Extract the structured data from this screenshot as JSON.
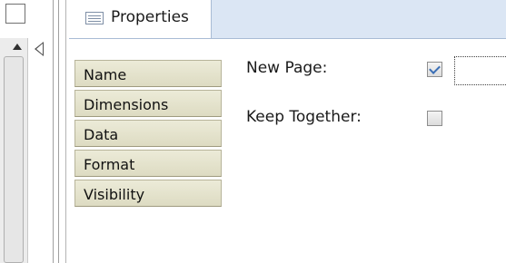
{
  "tab": {
    "label": "Properties"
  },
  "categories": [
    {
      "label": "Name"
    },
    {
      "label": "Dimensions"
    },
    {
      "label": "Data"
    },
    {
      "label": "Format"
    },
    {
      "label": "Visibility"
    }
  ],
  "properties": [
    {
      "label": "New Page:",
      "checked": true
    },
    {
      "label": "Keep Together:",
      "checked": false
    }
  ],
  "colors": {
    "tab_strip": "#dbe6f4",
    "category_bg": "#e4e2cc",
    "check_mark": "#3b6fb6"
  }
}
